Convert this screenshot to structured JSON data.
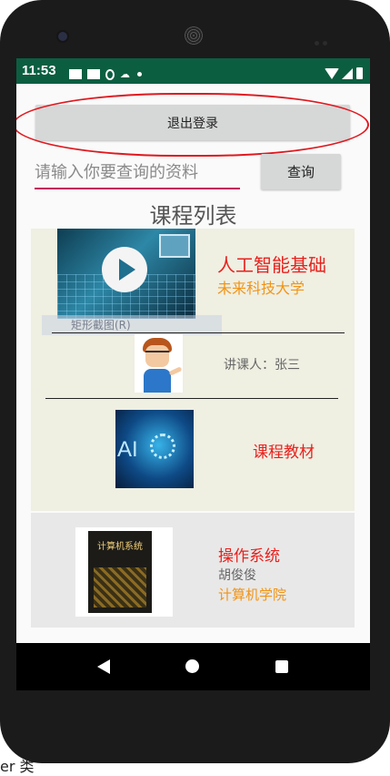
{
  "statusbar": {
    "time": "11:53"
  },
  "header": {
    "logout_label": "退出登录",
    "search_placeholder": "请输入你要查询的资料",
    "query_label": "查询"
  },
  "list": {
    "title": "课程列表"
  },
  "course1": {
    "name": "人工智能基础",
    "school": "未来科技大学",
    "ghost_label": "矩形截图(R)",
    "lecturer": "讲课人：张三",
    "material": "课程教材"
  },
  "course2": {
    "book_title": "计算机系统",
    "name": "操作系统",
    "teacher": "胡俊俊",
    "school": "计算机学院"
  },
  "footer": {
    "under_text": "er 类"
  },
  "colors": {
    "accent_red": "#e8211d",
    "accent_orange": "#f19416",
    "statusbar": "#0c5e41",
    "underline": "#c2185b"
  }
}
